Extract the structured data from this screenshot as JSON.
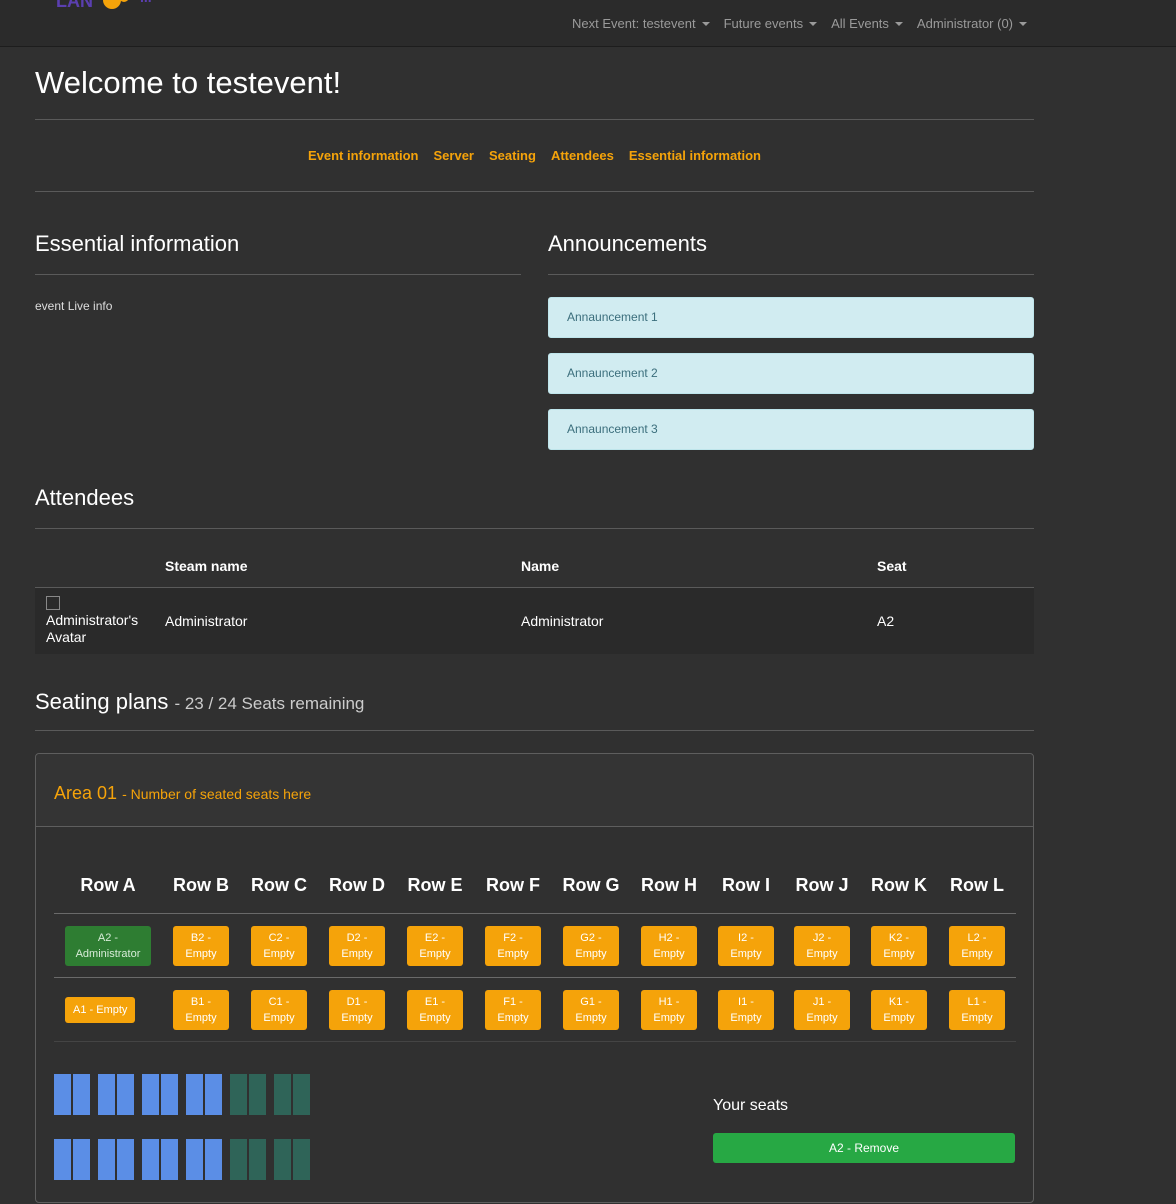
{
  "nav": {
    "next_event": "Next Event: testevent",
    "future_events": "Future events",
    "all_events": "All Events",
    "user": "Administrator (0)"
  },
  "page": {
    "welcome": "Welcome to testevent!"
  },
  "subnav": [
    "Event information",
    "Server",
    "Seating",
    "Attendees",
    "Essential information"
  ],
  "essential": {
    "title": "Essential information",
    "text": "event Live info"
  },
  "announcements": {
    "title": "Announcements",
    "items": [
      "Annauncement 1",
      "Annauncement 2",
      "Annauncement 3"
    ]
  },
  "attendees": {
    "title": "Attendees",
    "headers": [
      "Steam name",
      "Name",
      "Seat"
    ],
    "rows": [
      {
        "avatar_alt": "Administrator's Avatar",
        "steam_name": "Administrator",
        "name": "Administrator",
        "seat": "A2"
      }
    ]
  },
  "seating": {
    "title": "Seating plans",
    "remaining": "- 23 / 24 Seats remaining",
    "area_name": "Area 01",
    "area_note": "- Number of seated seats here",
    "row_headers": [
      "Row A",
      "Row B",
      "Row C",
      "Row D",
      "Row E",
      "Row F",
      "Row G",
      "Row H",
      "Row I",
      "Row J",
      "Row K",
      "Row L"
    ],
    "seat_rows": [
      [
        "A2 -\nAdministrator",
        "B2 -\nEmpty",
        "C2 -\nEmpty",
        "D2 -\nEmpty",
        "E2 -\nEmpty",
        "F2 -\nEmpty",
        "G2 -\nEmpty",
        "H2 -\nEmpty",
        "I2 -\nEmpty",
        "J2 -\nEmpty",
        "K2 -\nEmpty",
        "L2 -\nEmpty"
      ],
      [
        "A1 - Empty",
        "B1 -\nEmpty",
        "C1 -\nEmpty",
        "D1 -\nEmpty",
        "E1 -\nEmpty",
        "F1 -\nEmpty",
        "G1 -\nEmpty",
        "H1 -\nEmpty",
        "I1 -\nEmpty",
        "J1 -\nEmpty",
        "K1 -\nEmpty",
        "L1 -\nEmpty"
      ]
    ],
    "your_seats_title": "Your seats",
    "remove_label": "A2 - Remove"
  },
  "colors": {
    "accent": "#f5a30a",
    "taken": "#2e7d32",
    "remove": "#27a844",
    "map_available": "#5b8ee6",
    "map_other": "#2f6458"
  }
}
